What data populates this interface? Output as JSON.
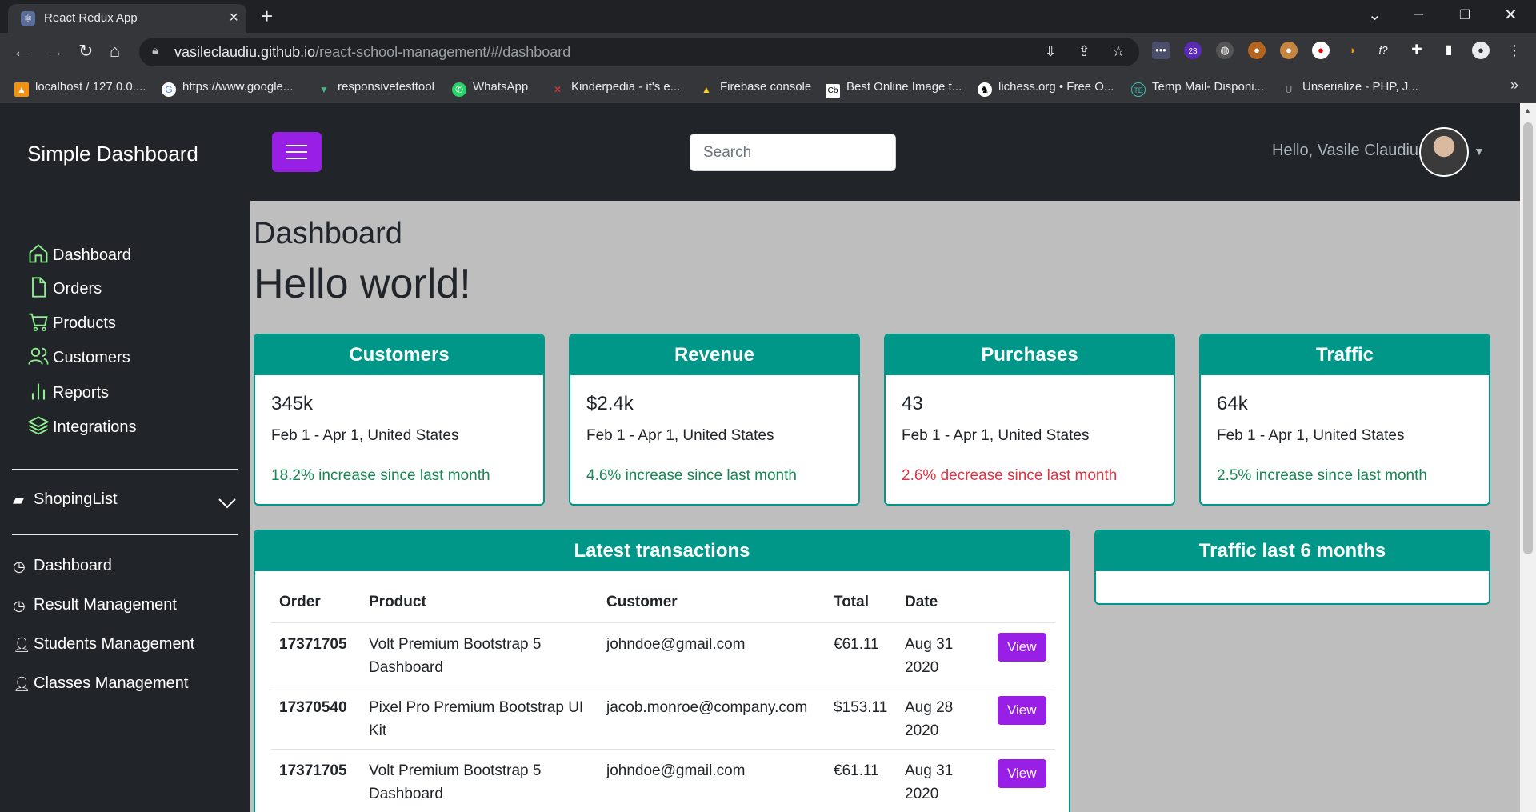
{
  "browser": {
    "tab_title": "React Redux App",
    "url_host": "vasileclaudiu.github.io",
    "url_path": "/react-school-management/#/dashboard",
    "extension_badge": "23",
    "bookmarks": [
      "localhost / 127.0.0....",
      "https://www.google...",
      "responsivetesttool",
      "WhatsApp",
      "Kinderpedia - it's e...",
      "Firebase console",
      "Best Online Image t...",
      "lichess.org • Free O...",
      "Temp Mail- Disponi...",
      "Unserialize - PHP, J..."
    ]
  },
  "header": {
    "brand": "Simple Dashboard",
    "search_placeholder": "Search",
    "greeting": "Hello, Vasile Claudiu"
  },
  "sidebar": {
    "items": [
      "Dashboard",
      "Orders",
      "Products",
      "Customers",
      "Reports",
      "Integrations"
    ],
    "group_label": "ShopingList",
    "items2": [
      "Dashboard",
      "Result Management",
      "Students Management",
      "Classes Management"
    ]
  },
  "page": {
    "title": "Dashboard",
    "subtitle": "Hello world!"
  },
  "stats": [
    {
      "title": "Customers",
      "value": "345k",
      "range": "Feb 1 - Apr 1, United States",
      "change": "18.2% increase since last month",
      "trend": "up"
    },
    {
      "title": "Revenue",
      "value": "$2.4k",
      "range": "Feb 1 - Apr 1, United States",
      "change": "4.6% increase since last month",
      "trend": "up"
    },
    {
      "title": "Purchases",
      "value": "43",
      "range": "Feb 1 - Apr 1, United States",
      "change": "2.6% decrease since last month",
      "trend": "down"
    },
    {
      "title": "Traffic",
      "value": "64k",
      "range": "Feb 1 - Apr 1, United States",
      "change": "2.5% increase since last month",
      "trend": "up"
    }
  ],
  "transactions": {
    "title": "Latest transactions",
    "headers": [
      "Order",
      "Product",
      "Customer",
      "Total",
      "Date"
    ],
    "view_label": "View",
    "rows": [
      {
        "order": "17371705",
        "product": "Volt Premium Bootstrap 5 Dashboard",
        "customer": "johndoe@gmail.com",
        "total": "€61.11",
        "date": "Aug 31 2020"
      },
      {
        "order": "17370540",
        "product": "Pixel Pro Premium Bootstrap UI Kit",
        "customer": "jacob.monroe@company.com",
        "total": "$153.11",
        "date": "Aug 28 2020"
      },
      {
        "order": "17371705",
        "product": "Volt Premium Bootstrap 5 Dashboard",
        "customer": "johndoe@gmail.com",
        "total": "€61.11",
        "date": "Aug 31 2020"
      }
    ]
  },
  "traffic_panel": {
    "title": "Traffic last 6 months"
  },
  "colors": {
    "accent": "#009688",
    "button": "#9a1fe6",
    "sidebar_icon": "#90ee90",
    "increase": "#198754",
    "decrease": "#dc3545"
  }
}
